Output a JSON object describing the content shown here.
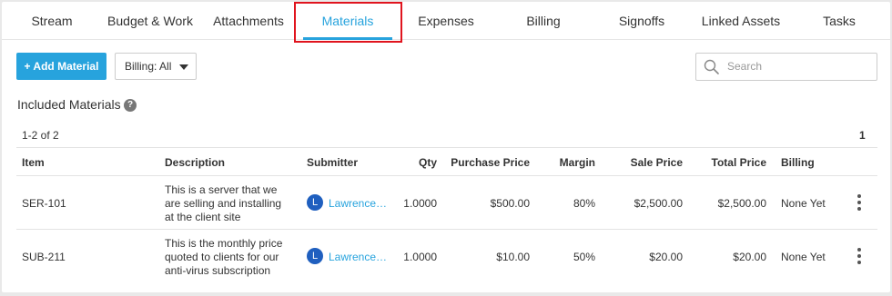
{
  "tabs": [
    {
      "label": "Stream"
    },
    {
      "label": "Budget & Work"
    },
    {
      "label": "Attachments"
    },
    {
      "label": "Materials"
    },
    {
      "label": "Expenses"
    },
    {
      "label": "Billing"
    },
    {
      "label": "Signoffs"
    },
    {
      "label": "Linked Assets"
    },
    {
      "label": "Tasks"
    }
  ],
  "active_tab": "Materials",
  "toolbar": {
    "add_label": "+ Add Material",
    "billing_filter": "Billing: All",
    "search_placeholder": "Search"
  },
  "section": {
    "title": "Included Materials",
    "help": "?"
  },
  "pagination": {
    "count": "1-2 of 2",
    "page": "1"
  },
  "table": {
    "headers": [
      "Item",
      "Description",
      "Submitter",
      "Qty",
      "Purchase Price",
      "Margin",
      "Sale Price",
      "Total Price",
      "Billing"
    ],
    "rows": [
      {
        "item": "SER-101",
        "description": [
          "This is a server that we",
          "are selling and installing",
          "at the client site"
        ],
        "submitter_initial": "L",
        "submitter": "Lawrence…",
        "qty": "1.0000",
        "purchase_price": "$500.00",
        "margin": "80%",
        "sale_price": "$2,500.00",
        "total_price": "$2,500.00",
        "billing": "None Yet"
      },
      {
        "item": "SUB-211",
        "description": [
          "This is the monthly price",
          "quoted to clients for our",
          "anti-virus subscription"
        ],
        "submitter_initial": "L",
        "submitter": "Lawrence…",
        "qty": "1.0000",
        "purchase_price": "$10.00",
        "margin": "50%",
        "sale_price": "$20.00",
        "total_price": "$20.00",
        "billing": "None Yet"
      }
    ]
  },
  "colors": {
    "accent": "#27a3dd",
    "highlight": "#e0141e",
    "avatar": "#1f5fbf"
  }
}
